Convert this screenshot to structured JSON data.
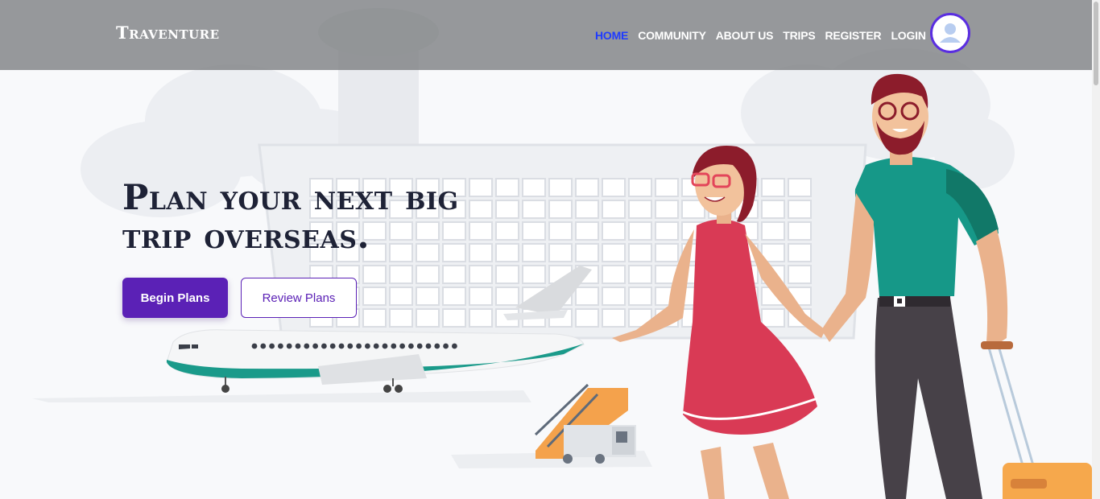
{
  "brand": {
    "name": "Traventure"
  },
  "nav": {
    "links": [
      {
        "label": "HOME",
        "active": true
      },
      {
        "label": "COMMUNITY",
        "active": false
      },
      {
        "label": "ABOUT US",
        "active": false
      },
      {
        "label": "TRIPS",
        "active": false
      },
      {
        "label": "REGISTER",
        "active": false
      },
      {
        "label": "LOGIN",
        "active": false
      }
    ],
    "avatar_icon": "user-avatar-icon"
  },
  "hero": {
    "title_line1": "Plan your next big",
    "title_line2": "trip overseas.",
    "primary_button": "Begin Plans",
    "secondary_button": "Review Plans"
  },
  "colors": {
    "accent": "#5b21b6",
    "active_link": "#1f3bff",
    "title": "#1e2236"
  }
}
